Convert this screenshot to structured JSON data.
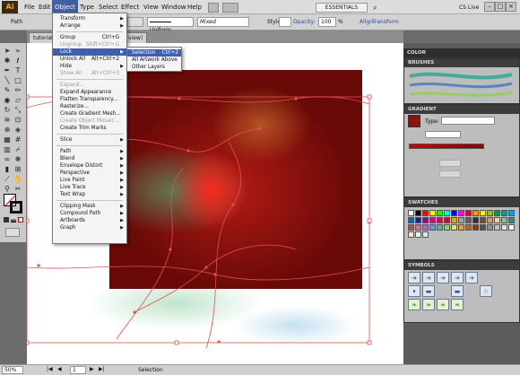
{
  "app": {
    "logo": "Ai"
  },
  "menubar": {
    "items": [
      "File",
      "Edit",
      "Object",
      "Type",
      "Select",
      "Effect",
      "View",
      "Window",
      "Help"
    ],
    "workspace": "ESSENTIALS",
    "cs_live": "CS Live"
  },
  "controlbar": {
    "selection_label": "Path",
    "stroke_profile": "Uniform",
    "brush": "Mixed",
    "style_label": "Style:",
    "opacity_label": "Opacity:",
    "opacity_value": "100",
    "opacity_unit": "%",
    "align_label": "Align",
    "transform_label": "Transform"
  },
  "tabs": {
    "doc_left": "tutorial",
    "doc_right": "view)"
  },
  "object_menu": {
    "items": [
      {
        "label": "Transform",
        "shortcut": "",
        "submenu": true,
        "disabled": false,
        "sep_after": false
      },
      {
        "label": "Arrange",
        "shortcut": "",
        "submenu": true,
        "disabled": false,
        "sep_after": true
      },
      {
        "label": "Group",
        "shortcut": "Ctrl+G",
        "submenu": false,
        "disabled": false,
        "sep_after": false
      },
      {
        "label": "Ungroup",
        "shortcut": "Shift+Ctrl+G",
        "submenu": false,
        "disabled": true,
        "sep_after": false
      },
      {
        "label": "Lock",
        "shortcut": "",
        "submenu": true,
        "disabled": false,
        "sep_after": false,
        "highlight": true
      },
      {
        "label": "Unlock All",
        "shortcut": "Alt+Ctrl+2",
        "submenu": false,
        "disabled": false,
        "sep_after": false
      },
      {
        "label": "Hide",
        "shortcut": "",
        "submenu": true,
        "disabled": false,
        "sep_after": false
      },
      {
        "label": "Show All",
        "shortcut": "Alt+Ctrl+3",
        "submenu": false,
        "disabled": true,
        "sep_after": true
      },
      {
        "label": "Expand...",
        "shortcut": "",
        "submenu": false,
        "disabled": true,
        "sep_after": false
      },
      {
        "label": "Expand Appearance",
        "shortcut": "",
        "submenu": false,
        "disabled": false,
        "sep_after": false
      },
      {
        "label": "Flatten Transparency...",
        "shortcut": "",
        "submenu": false,
        "disabled": false,
        "sep_after": false
      },
      {
        "label": "Rasterize...",
        "shortcut": "",
        "submenu": false,
        "disabled": false,
        "sep_after": false
      },
      {
        "label": "Create Gradient Mesh...",
        "shortcut": "",
        "submenu": false,
        "disabled": false,
        "sep_after": false
      },
      {
        "label": "Create Object Mosaic...",
        "shortcut": "",
        "submenu": false,
        "disabled": true,
        "sep_after": false
      },
      {
        "label": "Create Trim Marks",
        "shortcut": "",
        "submenu": false,
        "disabled": false,
        "sep_after": true
      },
      {
        "label": "Slice",
        "shortcut": "",
        "submenu": true,
        "disabled": false,
        "sep_after": true
      },
      {
        "label": "Path",
        "shortcut": "",
        "submenu": true,
        "disabled": false,
        "sep_after": false
      },
      {
        "label": "Blend",
        "shortcut": "",
        "submenu": true,
        "disabled": false,
        "sep_after": false
      },
      {
        "label": "Envelope Distort",
        "shortcut": "",
        "submenu": true,
        "disabled": false,
        "sep_after": false
      },
      {
        "label": "Perspective",
        "shortcut": "",
        "submenu": true,
        "disabled": false,
        "sep_after": false
      },
      {
        "label": "Live Paint",
        "shortcut": "",
        "submenu": true,
        "disabled": false,
        "sep_after": false
      },
      {
        "label": "Live Trace",
        "shortcut": "",
        "submenu": true,
        "disabled": false,
        "sep_after": false
      },
      {
        "label": "Text Wrap",
        "shortcut": "",
        "submenu": true,
        "disabled": false,
        "sep_after": true
      },
      {
        "label": "Clipping Mask",
        "shortcut": "",
        "submenu": true,
        "disabled": false,
        "sep_after": false
      },
      {
        "label": "Compound Path",
        "shortcut": "",
        "submenu": true,
        "disabled": false,
        "sep_after": false
      },
      {
        "label": "Artboards",
        "shortcut": "",
        "submenu": true,
        "disabled": false,
        "sep_after": false
      },
      {
        "label": "Graph",
        "shortcut": "",
        "submenu": true,
        "disabled": false,
        "sep_after": false
      }
    ]
  },
  "lock_submenu": {
    "items": [
      {
        "label": "Selection",
        "shortcut": "Ctrl+2",
        "highlight": true
      },
      {
        "label": "All Artwork Above",
        "shortcut": ""
      },
      {
        "label": "Other Layers",
        "shortcut": ""
      }
    ]
  },
  "panels": {
    "color": "COLOR",
    "brushes": "BRUSHES",
    "gradient": "GRADIENT",
    "gradient_type_label": "Type:",
    "swatches": "SWATCHES",
    "symbols": "SYMBOLS"
  },
  "status": {
    "zoom": "50%",
    "page": "1",
    "mode": "Selection"
  },
  "colors": {
    "menu_highlight": "#3f5fae",
    "artwork_red": "#c41c16",
    "path_stroke": "#e05050"
  }
}
